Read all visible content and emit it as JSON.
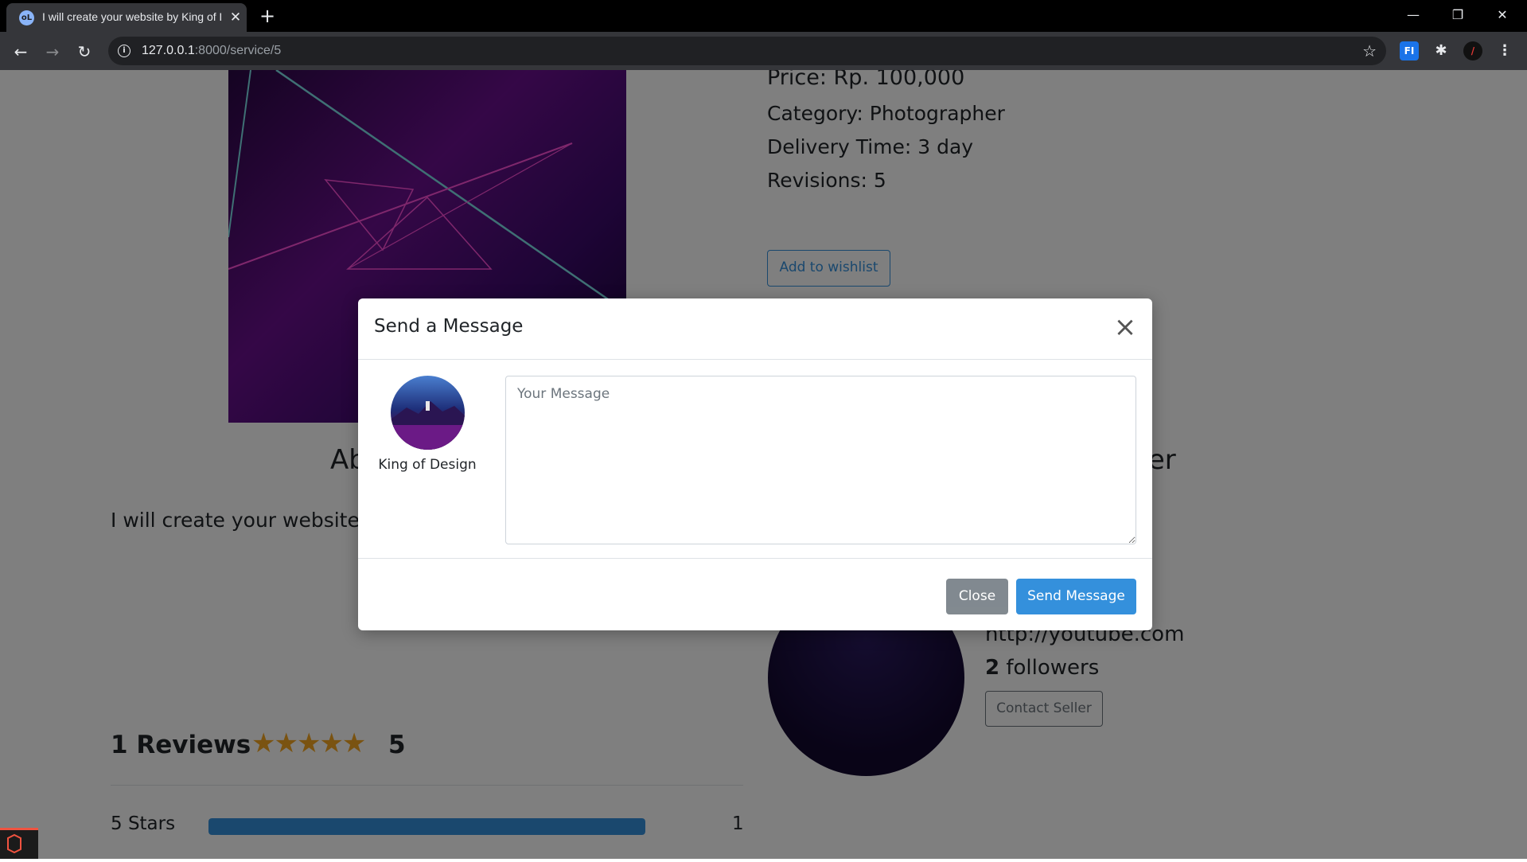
{
  "browser": {
    "tab_title": "I will create your website by King of Design",
    "tab_favicon_text": "oL",
    "url_host": "127.0.0.1",
    "url_path": ":8000/service/5",
    "ext_label": "FI"
  },
  "service": {
    "price": "Price: Rp. 100,000",
    "category": "Category: Photographer",
    "delivery": "Delivery Time: 3 day",
    "revisions": "Revisions: 5",
    "wishlist_label": "Add to wishlist",
    "about_left": "Ab",
    "about_right": "ller",
    "description": "I will create your website works"
  },
  "seller": {
    "link": "http://youtube.com",
    "followers_count": "2",
    "followers_label": " followers",
    "contact_label": "Contact Seller"
  },
  "reviews": {
    "title": "1 Reviews",
    "stars": "★★★★★",
    "rating": "5",
    "bars": [
      {
        "label": "5 Stars",
        "count": "1",
        "fraction": 1.0
      }
    ]
  },
  "modal": {
    "title": "Send a Message",
    "recipient_name": "King of Design",
    "message_placeholder": "Your Message",
    "close_label": "Close",
    "send_label": "Send Message"
  },
  "colors": {
    "primary": "#3490dc",
    "secondary": "#6c757d",
    "star": "#f5a623"
  }
}
